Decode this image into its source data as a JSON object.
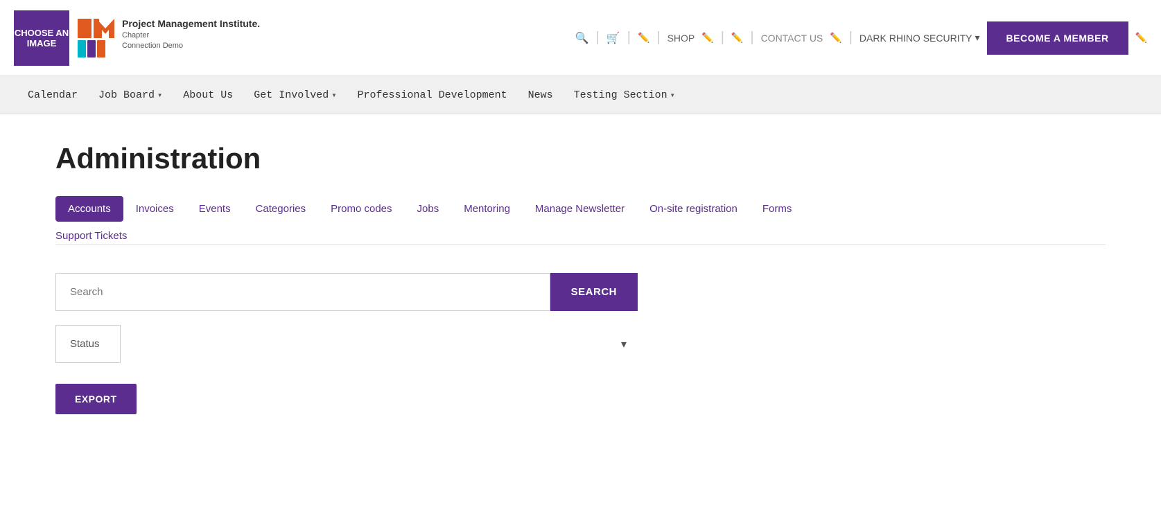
{
  "header": {
    "choose_image_label": "CHOOSE AN IMAGE",
    "pmi_name": "PM",
    "pmi_full": "Project Management Institute.",
    "pmi_sub1": "Chapter",
    "pmi_sub2": "Connection Demo",
    "shop_label": "SHOP",
    "contact_us_label": "CONTACT US",
    "dark_rhino_label": "DARK RHINO SECURITY",
    "become_member_label": "BECOME A MEMBER"
  },
  "nav": {
    "items": [
      {
        "label": "Calendar",
        "has_dropdown": false
      },
      {
        "label": "Job Board",
        "has_dropdown": true
      },
      {
        "label": "About Us",
        "has_dropdown": false
      },
      {
        "label": "Get Involved",
        "has_dropdown": true
      },
      {
        "label": "Professional Development",
        "has_dropdown": false
      },
      {
        "label": "News",
        "has_dropdown": false
      },
      {
        "label": "Testing Section",
        "has_dropdown": true
      }
    ]
  },
  "page": {
    "title": "Administration"
  },
  "tabs": {
    "items": [
      {
        "label": "Accounts",
        "active": true
      },
      {
        "label": "Invoices",
        "active": false
      },
      {
        "label": "Events",
        "active": false
      },
      {
        "label": "Categories",
        "active": false
      },
      {
        "label": "Promo codes",
        "active": false
      },
      {
        "label": "Jobs",
        "active": false
      },
      {
        "label": "Mentoring",
        "active": false
      },
      {
        "label": "Manage Newsletter",
        "active": false
      },
      {
        "label": "On-site registration",
        "active": false
      },
      {
        "label": "Forms",
        "active": false
      }
    ],
    "second_row": [
      {
        "label": "Support Tickets"
      }
    ]
  },
  "search": {
    "placeholder": "Search",
    "button_label": "SEARCH",
    "status_placeholder": "Status",
    "export_label": "EXPORT"
  }
}
